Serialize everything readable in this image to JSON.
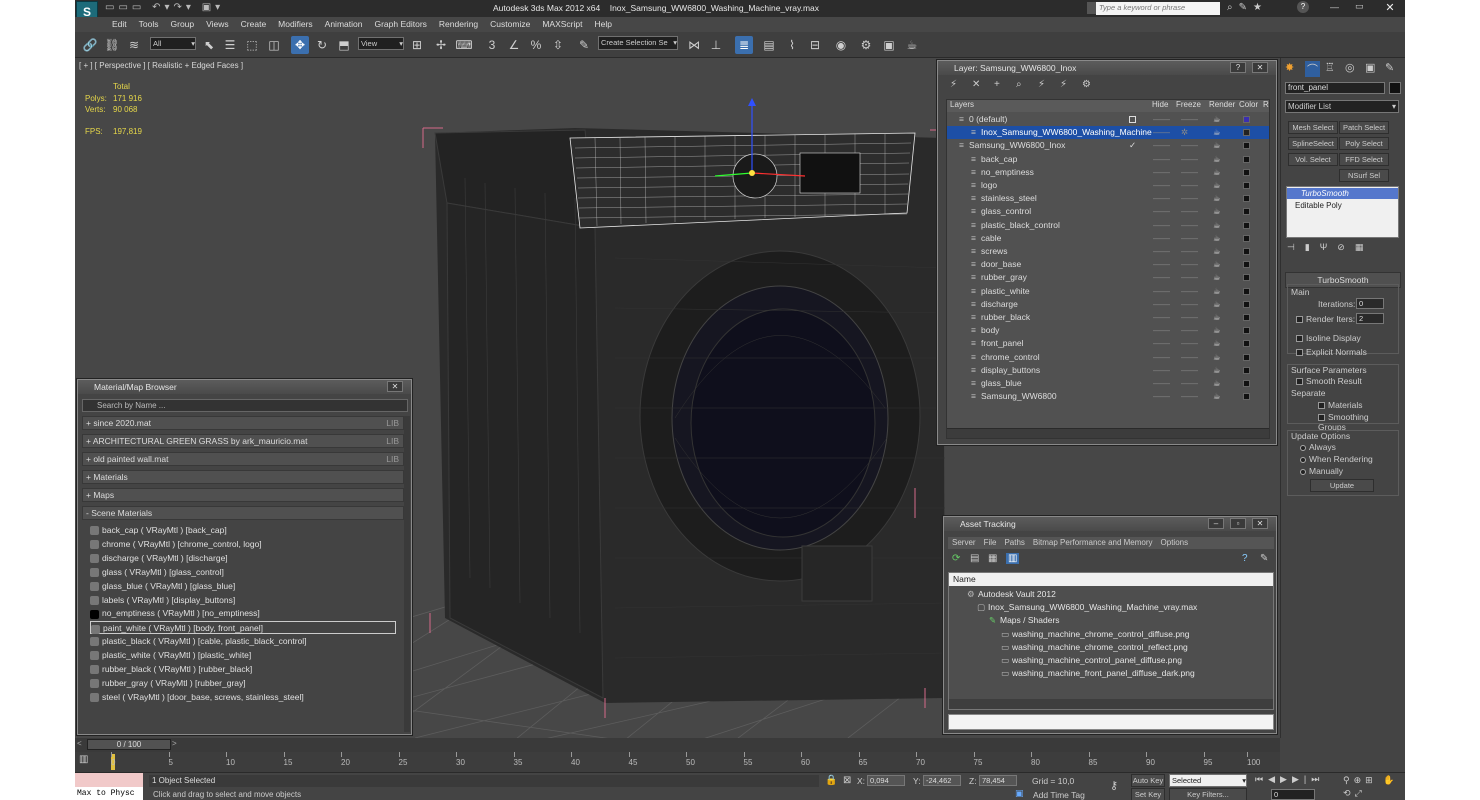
{
  "titlebar": {
    "app": "Autodesk 3ds Max  2012 x64",
    "file": "Inox_Samsung_WW6800_Washing_Machine_vray.max",
    "search_placeholder": "Type a keyword or phrase"
  },
  "menu": [
    "Edit",
    "Tools",
    "Group",
    "Views",
    "Create",
    "Modifiers",
    "Animation",
    "Graph Editors",
    "Rendering",
    "Customize",
    "MAXScript",
    "Help"
  ],
  "toolbar": {
    "filter": "All",
    "ref_coord": "View",
    "named_selection": "Create Selection Se"
  },
  "viewport": {
    "label": "[ + ] [ Perspective ] [ Realistic + Edged Faces ]",
    "stats_header": "Total",
    "polys_label": "Polys:",
    "polys": "171 916",
    "verts_label": "Verts:",
    "verts": "90 068",
    "fps_label": "FPS:",
    "fps": "197,819"
  },
  "layer_window": {
    "title": "Layer: Samsung_WW6800_Inox",
    "col_layers": "Layers",
    "col_hide": "Hide",
    "col_freeze": "Freeze",
    "col_render": "Render",
    "col_color": "Color",
    "col_r": "R",
    "rows": [
      {
        "name": "0 (default)",
        "indent": 0,
        "color": "#3b2fb0",
        "selected": false
      },
      {
        "name": "Inox_Samsung_WW6800_Washing_Machine",
        "indent": 1,
        "color": "#222222",
        "selected": true
      },
      {
        "name": "Samsung_WW6800_Inox",
        "indent": 0,
        "color": "#111111",
        "selected": false
      },
      {
        "name": "back_cap",
        "indent": 1,
        "color": "#111111",
        "selected": false
      },
      {
        "name": "no_emptiness",
        "indent": 1,
        "color": "#111111",
        "selected": false
      },
      {
        "name": "logo",
        "indent": 1,
        "color": "#111111",
        "selected": false
      },
      {
        "name": "stainless_steel",
        "indent": 1,
        "color": "#111111",
        "selected": false
      },
      {
        "name": "glass_control",
        "indent": 1,
        "color": "#111111",
        "selected": false
      },
      {
        "name": "plastic_black_control",
        "indent": 1,
        "color": "#111111",
        "selected": false
      },
      {
        "name": "cable",
        "indent": 1,
        "color": "#111111",
        "selected": false
      },
      {
        "name": "screws",
        "indent": 1,
        "color": "#111111",
        "selected": false
      },
      {
        "name": "door_base",
        "indent": 1,
        "color": "#111111",
        "selected": false
      },
      {
        "name": "rubber_gray",
        "indent": 1,
        "color": "#111111",
        "selected": false
      },
      {
        "name": "plastic_white",
        "indent": 1,
        "color": "#111111",
        "selected": false
      },
      {
        "name": "discharge",
        "indent": 1,
        "color": "#111111",
        "selected": false
      },
      {
        "name": "rubber_black",
        "indent": 1,
        "color": "#111111",
        "selected": false
      },
      {
        "name": "body",
        "indent": 1,
        "color": "#111111",
        "selected": false
      },
      {
        "name": "front_panel",
        "indent": 1,
        "color": "#111111",
        "selected": false
      },
      {
        "name": "chrome_control",
        "indent": 1,
        "color": "#111111",
        "selected": false
      },
      {
        "name": "display_buttons",
        "indent": 1,
        "color": "#111111",
        "selected": false
      },
      {
        "name": "glass_blue",
        "indent": 1,
        "color": "#111111",
        "selected": false
      },
      {
        "name": "Samsung_WW6800",
        "indent": 1,
        "color": "#111111",
        "selected": false
      }
    ]
  },
  "material_browser": {
    "title": "Material/Map Browser",
    "search_placeholder": "Search by Name ...",
    "groups": [
      {
        "label": "+ since 2020.mat",
        "tag": "LIB"
      },
      {
        "label": "+ ARCHITECTURAL GREEN GRASS by ark_mauricio.mat",
        "tag": "LIB"
      },
      {
        "label": "+ old painted wall.mat",
        "tag": "LIB"
      },
      {
        "label": "+ Materials",
        "tag": ""
      },
      {
        "label": "+ Maps",
        "tag": ""
      },
      {
        "label": "- Scene Materials",
        "tag": ""
      }
    ],
    "materials": [
      "back_cap  ( VRayMtl ) [back_cap]",
      "chrome  ( VRayMtl ) [chrome_control, logo]",
      "discharge  ( VRayMtl ) [discharge]",
      "glass  ( VRayMtl ) [glass_control]",
      "glass_blue  ( VRayMtl ) [glass_blue]",
      "labels  ( VRayMtl ) [display_buttons]",
      "no_emptiness  ( VRayMtl ) [no_emptiness]",
      "paint_white  ( VRayMtl ) [body, front_panel]",
      "plastic_black  ( VRayMtl ) [cable, plastic_black_control]",
      "plastic_white  ( VRayMtl ) [plastic_white]",
      "rubber_black  ( VRayMtl ) [rubber_black]",
      "rubber_gray  ( VRayMtl ) [rubber_gray]",
      "steel  ( VRayMtl ) [door_base, screws, stainless_steel]"
    ]
  },
  "asset_tracking": {
    "title": "Asset Tracking",
    "menu": [
      "Server",
      "File",
      "Paths",
      "Bitmap Performance and Memory",
      "Options"
    ],
    "col_name": "Name",
    "rows": [
      "Autodesk Vault 2012",
      "Inox_Samsung_WW6800_Washing_Machine_vray.max",
      "Maps / Shaders",
      "washing_machine_chrome_control_diffuse.png",
      "washing_machine_chrome_control_reflect.png",
      "washing_machine_control_panel_diffuse.png",
      "washing_machine_front_panel_diffuse_dark.png"
    ]
  },
  "command_panel": {
    "object_name": "front_panel",
    "modifier_list": "Modifier List",
    "buttons": [
      "Mesh Select",
      "Patch Select",
      "SplineSelect",
      "Poly Select",
      "Vol. Select",
      "FFD Select",
      "NSurf Sel"
    ],
    "stack": [
      "TurboSmooth",
      "Editable Poly"
    ],
    "rollout_title": "TurboSmooth",
    "main_label": "Main",
    "iterations_label": "Iterations:",
    "iterations": "0",
    "render_iters_label": "Render Iters:",
    "render_iters": "2",
    "isoline": "Isoline Display",
    "explicit": "Explicit Normals",
    "surface_label": "Surface Parameters",
    "smooth_result": "Smooth Result",
    "separate_label": "Separate",
    "materials": "Materials",
    "smoothing_groups": "Smoothing Groups",
    "update_label": "Update Options",
    "always": "Always",
    "when_rendering": "When Rendering",
    "manually": "Manually",
    "update_btn": "Update"
  },
  "timeline": {
    "frame": "0 / 100",
    "ticks": [
      "0",
      "5",
      "10",
      "15",
      "20",
      "25",
      "30",
      "35",
      "40",
      "45",
      "50",
      "55",
      "60",
      "65",
      "70",
      "75",
      "80",
      "85",
      "90",
      "95",
      "100"
    ]
  },
  "status": {
    "maxscript": "Max to Physc",
    "selected": "1 Object Selected",
    "prompt": "Click and drag to select and move objects",
    "x_label": "X:",
    "x": "0,094",
    "y_label": "Y:",
    "y": "-24,462",
    "z_label": "Z:",
    "z": "78,454",
    "grid": "Grid = 10,0",
    "add_time_tag": "Add Time Tag",
    "auto_key": "Auto Key",
    "set_key": "Set Key",
    "key_mode": "Selected",
    "key_filters": "Key Filters...",
    "frame_field": "0"
  },
  "colors": {
    "selection": "#1d4fa6",
    "accent": "#3b6fae",
    "viewport_bg": "#474747"
  }
}
